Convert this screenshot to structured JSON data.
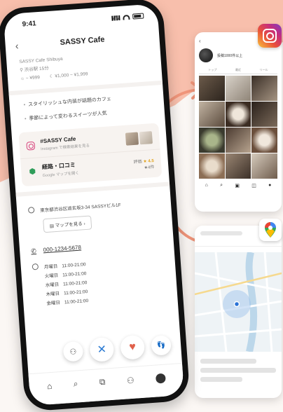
{
  "status": {
    "time": "9:41"
  },
  "header": {
    "title": "SASSY Cafe"
  },
  "info": {
    "subtitle": "SASSY Cafe Shibuya",
    "area": "渋谷駅 15分",
    "budget_lunch": "~ ¥999",
    "budget_dinner": "¥1,000 ~ ¥1,999"
  },
  "features": [
    "スタイリッシュな内装が話題のカフェ",
    "季節によって変わるスイーツが人気"
  ],
  "links": {
    "instagram": {
      "title": "#SASSY Cafe",
      "sub": "Instagram で検索結果を見る"
    },
    "reviews": {
      "title": "経路・口コミ",
      "sub": "Google マップを開く",
      "rating_label": "評価",
      "rating": "★ 4.5",
      "count": "★4件"
    }
  },
  "address": {
    "text": "東京都渋谷区道玄坂3-34 SASSYビル1F",
    "map_button": "マップを見る"
  },
  "phone": "000-1234-5678",
  "hours": [
    {
      "day": "月曜日",
      "time": "11:00-21:00"
    },
    {
      "day": "火曜日",
      "time": "11:00-21:00"
    },
    {
      "day": "水曜日",
      "time": "11:00-21:00"
    },
    {
      "day": "木曜日",
      "time": "11:00-21:00"
    },
    {
      "day": "金曜日",
      "time": "11:00-21:00"
    }
  ],
  "instagram_card": {
    "count": "投稿1000件以上",
    "tabs": [
      "トップ",
      "最近",
      "リール"
    ]
  },
  "colors": {
    "accent": "#f3a58d",
    "pin": "#2f9d5a",
    "star": "#e0a21b"
  }
}
